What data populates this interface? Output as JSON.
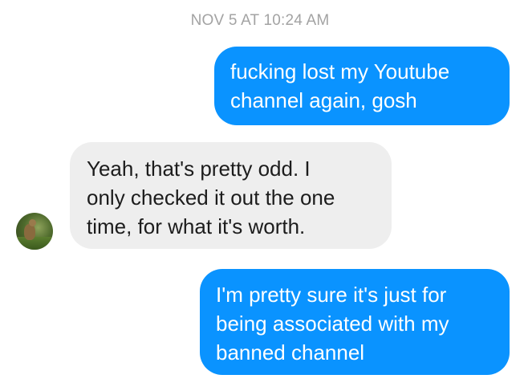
{
  "conversation": {
    "timestamp": "NOV 5 AT 10:24 AM",
    "messages": [
      {
        "direction": "outgoing",
        "text": "fucking lost my Youtube\nchannel again, gosh"
      },
      {
        "direction": "incoming",
        "text": "Yeah, that's pretty odd. I\nonly checked it out the one\ntime, for what it's worth."
      },
      {
        "direction": "outgoing",
        "text": "I'm pretty sure it's just for\nbeing associated with my\nbanned channel"
      }
    ],
    "avatar_icon": "contact-avatar-photo"
  },
  "colors": {
    "outgoing_bubble": "#0a93ff",
    "incoming_bubble": "#eeeeee",
    "timestamp_text": "#a3a3a3"
  }
}
